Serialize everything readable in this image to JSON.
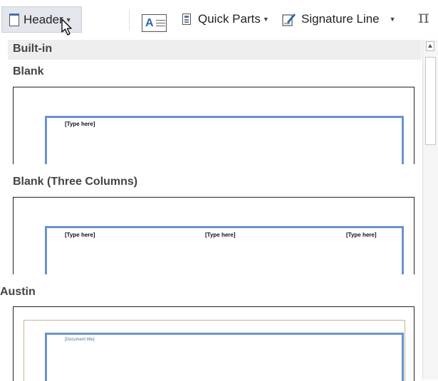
{
  "ribbon": {
    "header_label": "Header",
    "quick_parts_label": "Quick Parts",
    "signature_line_label": "Signature Line",
    "icons": [
      "page-header-icon",
      "caret-down-icon",
      "text-box-icon",
      "quick-parts-icon",
      "signature-line-icon",
      "equation-icon",
      "mouse-pointer-icon"
    ],
    "pi_glyph": "π",
    "textbox_glyph": "A"
  },
  "gallery": {
    "section_label": "Built-in",
    "items": [
      {
        "title": "Blank",
        "placeholders": [
          "[Type here]"
        ]
      },
      {
        "title": "Blank (Three Columns)",
        "placeholders": [
          "[Type here]",
          "[Type here]",
          "[Type here]"
        ]
      },
      {
        "title": "Austin",
        "placeholders": [
          "[Document title]"
        ]
      }
    ]
  },
  "colors": {
    "accent_blue": "#6a93cc",
    "austin_border": "#c8b58e",
    "section_bg": "#eeeeee",
    "hover_bg": "#e3e6ec"
  }
}
